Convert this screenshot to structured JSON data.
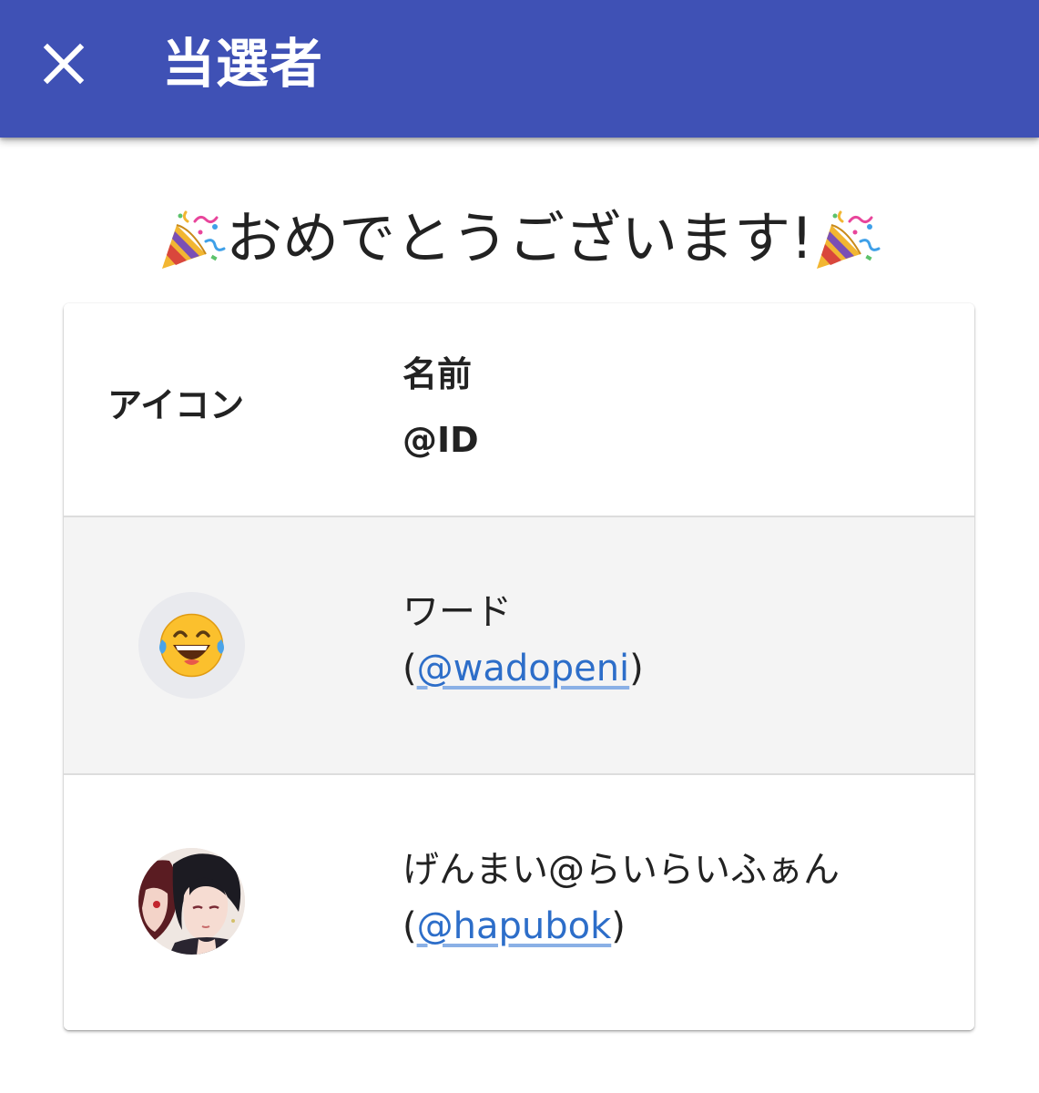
{
  "appbar": {
    "title": "当選者",
    "close_icon": "close-icon",
    "background_color": "#3f51b5"
  },
  "congrats": {
    "text": "おめでとうございます!",
    "left_icon": "party-popper-icon",
    "right_icon": "party-popper-icon"
  },
  "table": {
    "headers": {
      "icon": "アイコン",
      "name": "名前",
      "id": "@ID"
    },
    "rows": [
      {
        "avatar": "laughing-crying-emoji-avatar",
        "name": "ワード",
        "open_paren": "(",
        "handle": "@wadopeni",
        "close_paren": ")"
      },
      {
        "avatar": "anime-character-avatar",
        "name": "げんまい@らいらいふぁん",
        "open_paren": "(",
        "handle": "@hapubok",
        "close_paren": ")"
      }
    ]
  },
  "colors": {
    "link": "#2d6ec9",
    "row_alt": "#f4f4f4"
  }
}
